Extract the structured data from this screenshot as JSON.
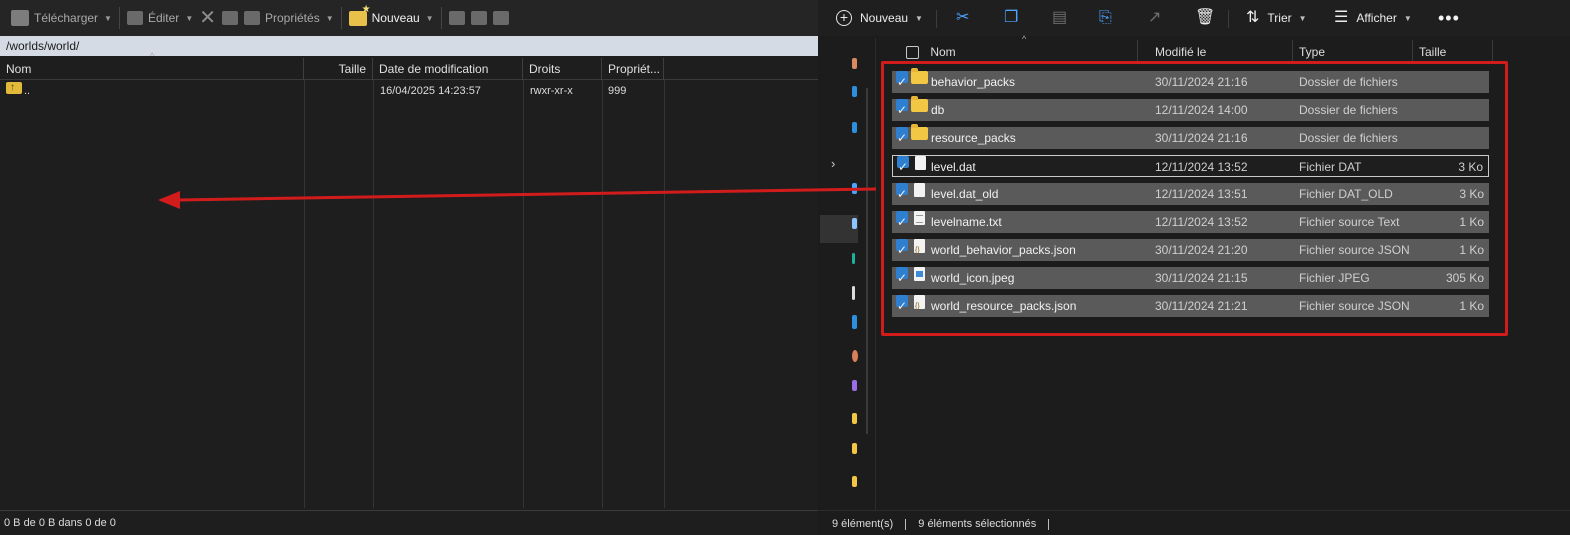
{
  "left": {
    "toolbar": {
      "download_label": "Télécharger",
      "edit_label": "Éditer",
      "properties_label": "Propriétés",
      "new_label": "Nouveau"
    },
    "path": "/worlds/world/",
    "columns": [
      "Nom",
      "Taille",
      "Date de modification",
      "Droits",
      "Propriét..."
    ],
    "rows": [
      {
        "name": "..",
        "size": "",
        "date": "16/04/2025 14:23:57",
        "rights": "rwxr-xr-x",
        "owner": "999"
      }
    ],
    "status": "0 B de 0 B dans 0 de 0"
  },
  "right": {
    "toolbar": {
      "new_label": "Nouveau",
      "sort_label": "Trier",
      "view_label": "Afficher"
    },
    "columns": [
      "Nom",
      "Modifié le",
      "Type",
      "Taille"
    ],
    "rows": [
      {
        "name": "behavior_packs",
        "date": "30/11/2024 21:16",
        "type": "Dossier de fichiers",
        "size": "",
        "icon": "folder-icon",
        "checked": true
      },
      {
        "name": "db",
        "date": "12/11/2024 14:00",
        "type": "Dossier de fichiers",
        "size": "",
        "icon": "folder-icon",
        "checked": true
      },
      {
        "name": "resource_packs",
        "date": "30/11/2024 21:16",
        "type": "Dossier de fichiers",
        "size": "",
        "icon": "folder-icon",
        "checked": true
      },
      {
        "name": "level.dat",
        "date": "12/11/2024 13:52",
        "type": "Fichier DAT",
        "size": "3 Ko",
        "icon": "file-icon",
        "checked": true
      },
      {
        "name": "level.dat_old",
        "date": "12/11/2024 13:51",
        "type": "Fichier DAT_OLD",
        "size": "3 Ko",
        "icon": "file-icon",
        "checked": true
      },
      {
        "name": "levelname.txt",
        "date": "12/11/2024 13:52",
        "type": "Fichier source Text",
        "size": "1 Ko",
        "icon": "text-file-icon",
        "checked": true
      },
      {
        "name": "world_behavior_packs.json",
        "date": "30/11/2024 21:20",
        "type": "Fichier source JSON",
        "size": "1 Ko",
        "icon": "json-file-icon",
        "checked": true
      },
      {
        "name": "world_icon.jpeg",
        "date": "30/11/2024 21:15",
        "type": "Fichier JPEG",
        "size": "305 Ko",
        "icon": "image-file-icon",
        "checked": true
      },
      {
        "name": "world_resource_packs.json",
        "date": "30/11/2024 21:21",
        "type": "Fichier source JSON",
        "size": "1 Ko",
        "icon": "json-file-icon",
        "checked": true
      }
    ],
    "status": {
      "count": "9 élément(s)",
      "selected": "9 éléments sélectionnés"
    }
  },
  "colors": {
    "highlight_box": "#d21c1c",
    "arrow": "#d21c1c",
    "path_bar": "#d4dbe4",
    "selected_row": "#5a5a5a",
    "checkbox": "#2f7fd1"
  }
}
